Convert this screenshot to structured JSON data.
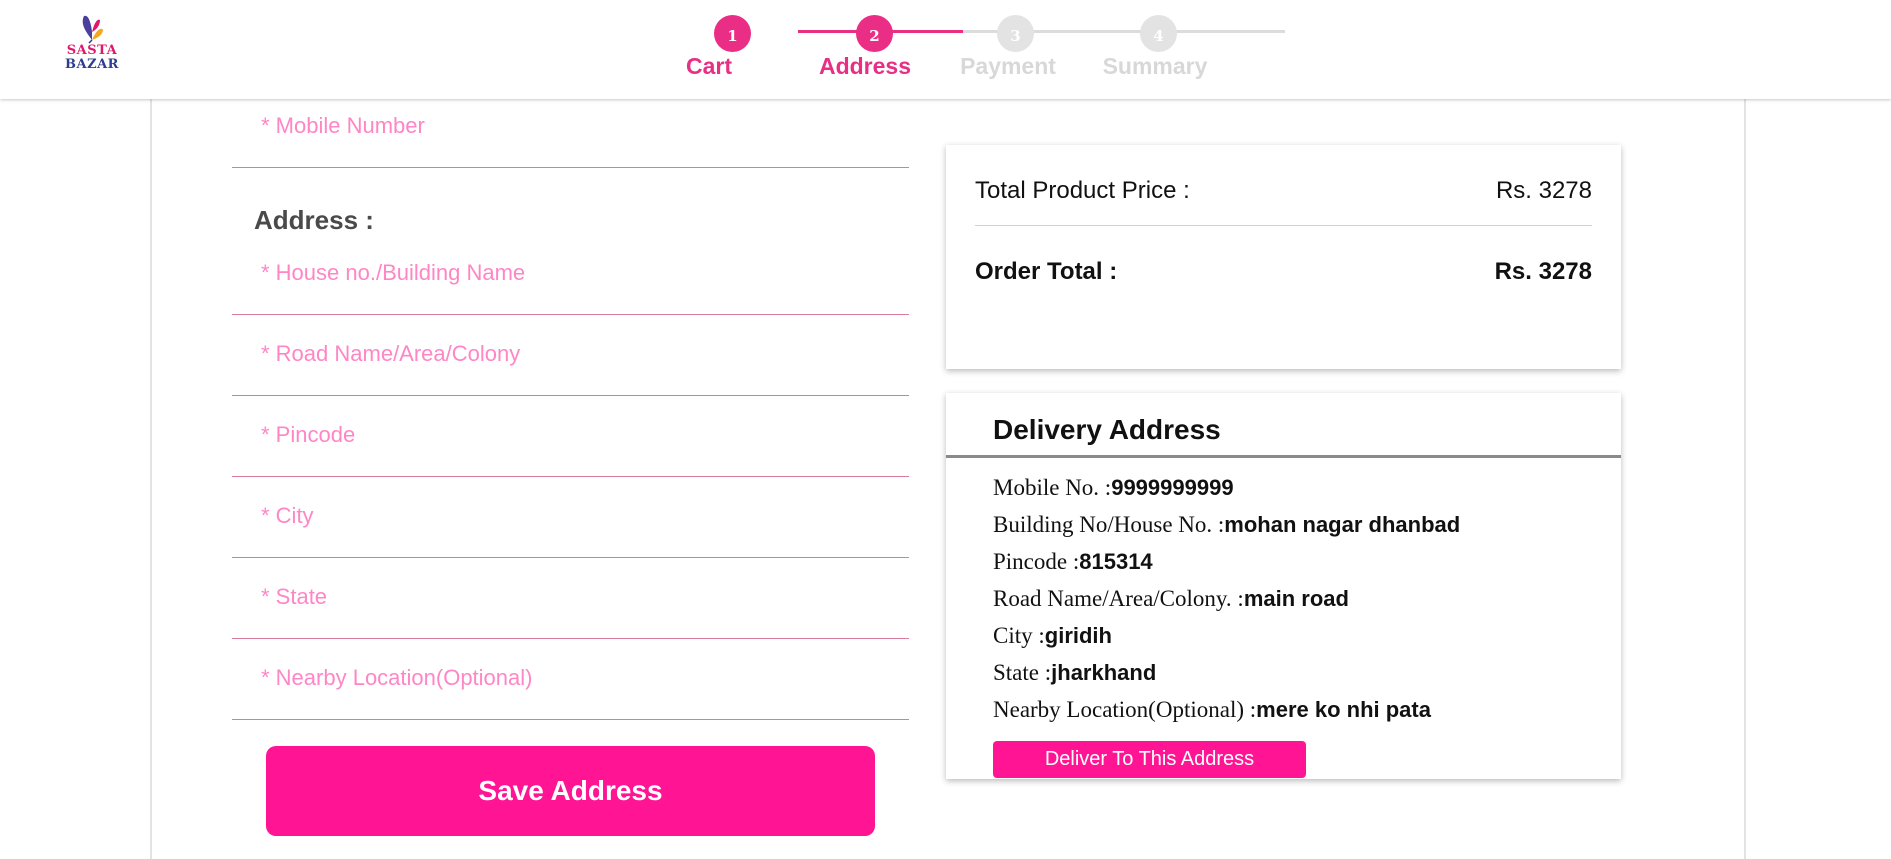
{
  "brand": {
    "logo_line1": "SASTA",
    "logo_line2": "BAZAR",
    "colors": {
      "accent": "#ff1493",
      "stepper_active": "#ea2e86",
      "stepper_inactive": "#e3e3e3",
      "field_label": "#ff86c6"
    }
  },
  "stepper": {
    "steps": [
      {
        "number": "1",
        "label": "Cart",
        "state": "completed"
      },
      {
        "number": "2",
        "label": "Address",
        "state": "active"
      },
      {
        "number": "3",
        "label": "Payment",
        "state": "inactive"
      },
      {
        "number": "4",
        "label": "Summary",
        "state": "inactive"
      }
    ]
  },
  "address_form": {
    "mobile_placeholder": "* Mobile Number",
    "section_heading": "Address :",
    "fields": [
      "* House no./Building Name",
      "* Road Name/Area/Colony",
      "* Pincode",
      "* City",
      "* State",
      "* Nearby Location(Optional)"
    ],
    "save_label": "Save Address"
  },
  "price_summary": {
    "total_product_label": "Total Product Price :",
    "total_product_value": "Rs. 3278",
    "order_total_label": "Order Total :",
    "order_total_value": "Rs. 3278"
  },
  "delivery_address": {
    "title": "Delivery Address",
    "lines": [
      {
        "label": "Mobile No. :",
        "value": "9999999999"
      },
      {
        "label": "Building No/House No. :",
        "value": "mohan nagar dhanbad"
      },
      {
        "label": "Pincode :",
        "value": "815314"
      },
      {
        "label": "Road Name/Area/Colony. :",
        "value": "main road"
      },
      {
        "label": "City :",
        "value": "giridih"
      },
      {
        "label": "State :",
        "value": "jharkhand"
      },
      {
        "label": "Nearby Location(Optional) :",
        "value": "mere ko nhi pata"
      }
    ],
    "deliver_label": "Deliver To This Address"
  }
}
